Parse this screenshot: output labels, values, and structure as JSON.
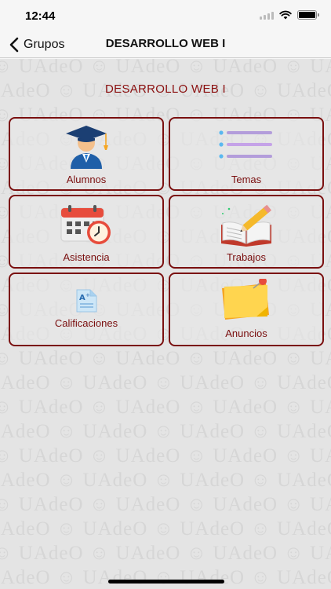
{
  "status_bar": {
    "time": "12:44"
  },
  "nav": {
    "back_label": "Grupos",
    "title": "DESARROLLO WEB I"
  },
  "section_title": "DESARROLLO WEB I",
  "watermark_text": "UAdeO",
  "menu": [
    {
      "label": "Alumnos",
      "icon": "graduate-icon"
    },
    {
      "label": "Temas",
      "icon": "list-lines-icon"
    },
    {
      "label": "Asistencia",
      "icon": "calendar-clock-icon"
    },
    {
      "label": "Trabajos",
      "icon": "book-pencil-icon"
    },
    {
      "label": "Calificaciones",
      "icon": "grade-document-icon"
    },
    {
      "label": "Anuncios",
      "icon": "sticky-note-icon"
    }
  ],
  "colors": {
    "accent": "#7a0f0f",
    "title_red": "#8b1010"
  }
}
